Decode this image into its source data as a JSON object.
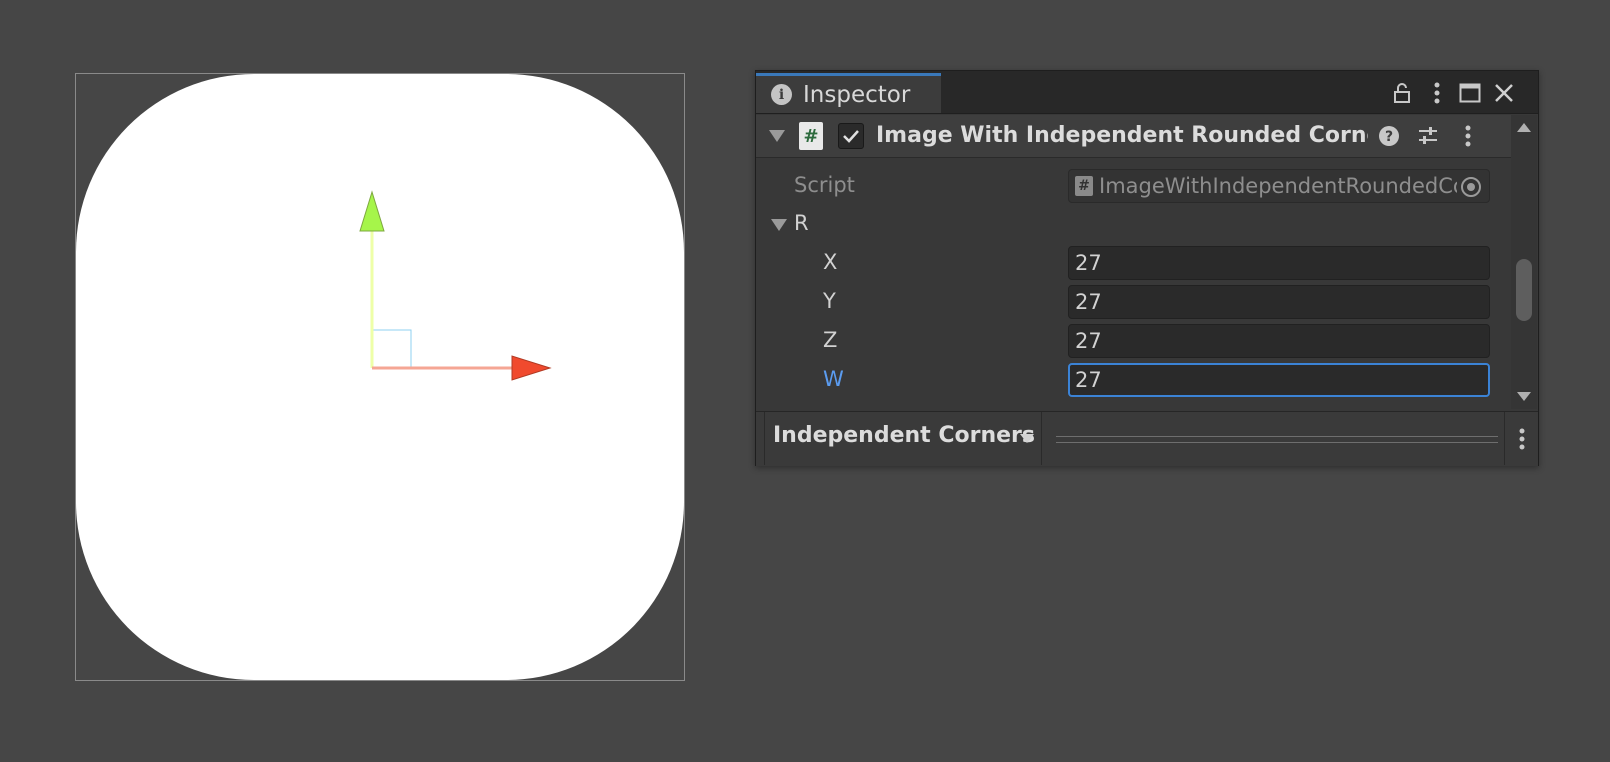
{
  "inspector": {
    "tab_label": "Inspector",
    "component": {
      "title": "Image With Independent Rounded Corners (",
      "enabled": true,
      "script_label": "Script",
      "script_value": "ImageWithIndependentRoundedCorners",
      "r_label": "R",
      "fields": [
        {
          "label": "X",
          "value": "27"
        },
        {
          "label": "Y",
          "value": "27"
        },
        {
          "label": "Z",
          "value": "27"
        },
        {
          "label": "W",
          "value": "27",
          "focused": true
        }
      ]
    },
    "bottom": {
      "dropdown_label": "Independent Corners"
    }
  },
  "colors": {
    "focus_label": "#5b9cf0",
    "gizmo_x": "#f04a2e",
    "gizmo_y": "#a6f54a",
    "accent": "#3a79bb"
  },
  "icons": [
    "info-icon",
    "lock-icon",
    "kebab-menu-icon",
    "maximize-icon",
    "close-icon",
    "script-hash-icon",
    "checkmark-icon",
    "help-icon",
    "presets-icon",
    "object-picker-icon"
  ]
}
